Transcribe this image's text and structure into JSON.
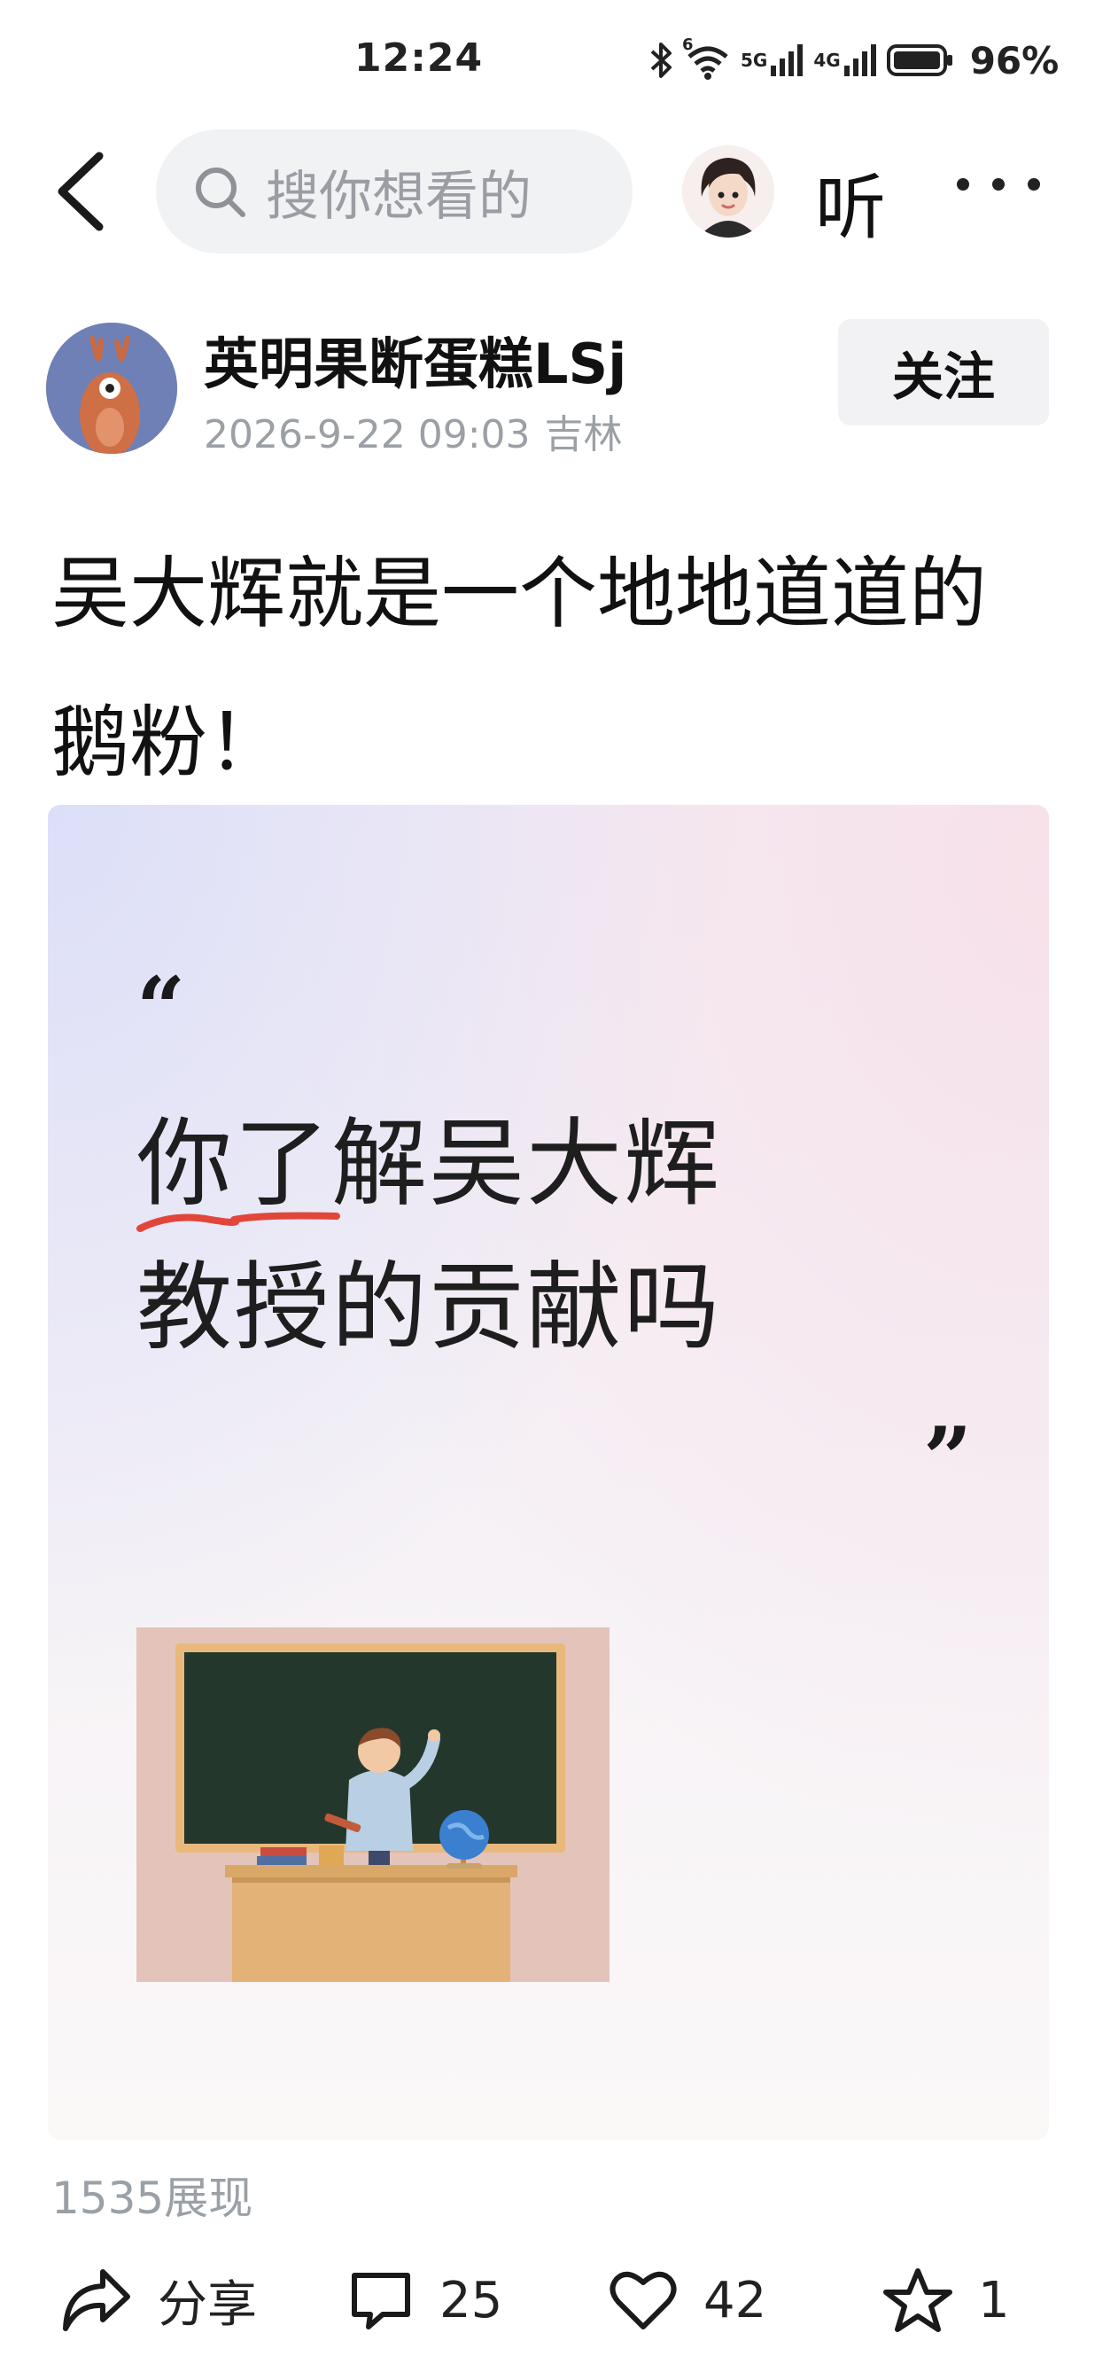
{
  "status_bar": {
    "time": "12:24",
    "signal_1": "5G",
    "signal_2": "4G",
    "wifi_badge": "6",
    "battery": "96%"
  },
  "nav": {
    "search_placeholder": "搜你想看的",
    "listen_label": "听"
  },
  "author": {
    "name": "英明果断蛋糕LSj",
    "date": "2026-9-22 09:03",
    "location": "吉林",
    "follow_label": "关注"
  },
  "post": {
    "title": "吴大辉就是一个地地道道的鹅粉！",
    "image": {
      "quote_open": "“",
      "quote_close": "”",
      "line1": "你了解吴大辉",
      "line2": "教授的贡献吗"
    },
    "views": "1535展现"
  },
  "actions": {
    "share": "分享",
    "comments": "25",
    "likes": "42",
    "favorites": "1"
  },
  "colors": {
    "accent_underline": "#e2463b",
    "muted_text": "#9ba0a6",
    "search_bg": "#f1f2f4"
  }
}
